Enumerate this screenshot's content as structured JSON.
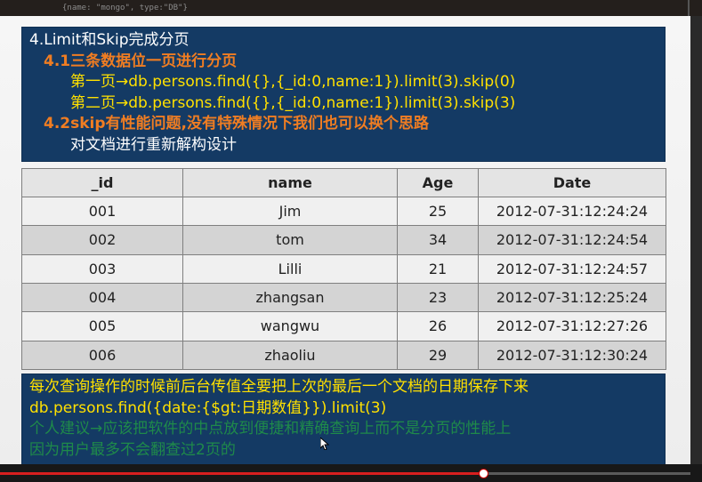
{
  "top_strip": {
    "code_fragment": "{name: \"mongo\", type:\"DB\"}"
  },
  "top_panel": {
    "lines": [
      {
        "text": "4.Limit和Skip完成分页"
      },
      {
        "text": "4.1三条数据位一页进行分页"
      },
      {
        "text": "第一页→db.persons.find({},{_id:0,name:1}).limit(3).skip(0)"
      },
      {
        "text": "第二页→db.persons.find({},{_id:0,name:1}).limit(3).skip(3)"
      },
      {
        "text": "4.2skip有性能问题,没有特殊情况下我们也可以换个思路"
      },
      {
        "text": "对文档进行重新解构设计"
      }
    ]
  },
  "table": {
    "headers": [
      "_id",
      "name",
      "Age",
      "Date"
    ],
    "rows": [
      [
        "001",
        "Jim",
        "25",
        "2012-07-31:12:24:24"
      ],
      [
        "002",
        "tom",
        "34",
        "2012-07-31:12:24:54"
      ],
      [
        "003",
        "Lilli",
        "21",
        "2012-07-31:12:24:57"
      ],
      [
        "004",
        "zhangsan",
        "23",
        "2012-07-31:12:25:24"
      ],
      [
        "005",
        "wangwu",
        "26",
        "2012-07-31:12:27:26"
      ],
      [
        "006",
        "zhaoliu",
        "29",
        "2012-07-31:12:30:24"
      ]
    ]
  },
  "bottom_panel": {
    "lines": [
      {
        "text": "每次查询操作的时候前后台传值全要把上次的最后一个文档的日期保存下来"
      },
      {
        "text": "db.persons.find({date:{$gt:日期数值}}).limit(3)"
      },
      {
        "text": "个人建议→应该把软件的中点放到便捷和精确查询上而不是分页的性能上"
      },
      {
        "text": "因为用户最多不会翻查过2页的"
      }
    ]
  },
  "colors": {
    "panel_bg": "#143a64",
    "heading_orange": "#f07d22",
    "code_yellow": "#ffe000",
    "note_green": "#1f8a4a",
    "progress_red": "#d81f1f"
  },
  "player": {
    "progress": 0.7
  }
}
